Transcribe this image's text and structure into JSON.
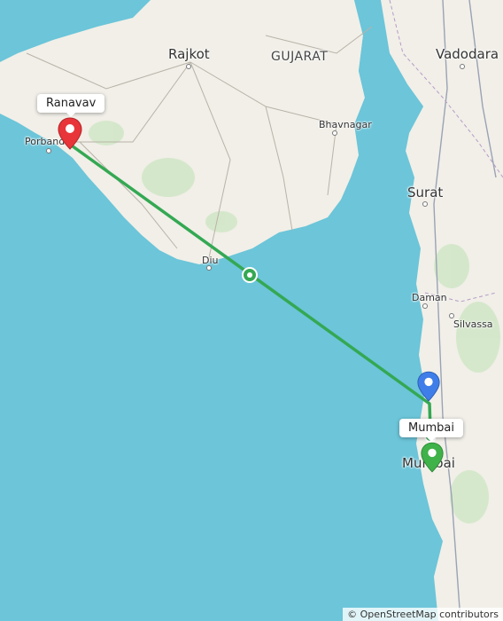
{
  "map": {
    "labels": {
      "rajkot": "Rajkot",
      "gujarat": "GUJARAT",
      "vadodara": "Vadodara",
      "bhavnagar": "Bhavnagar",
      "porbandar": "Porbandar",
      "surat": "Surat",
      "diu": "Diu",
      "daman": "Daman",
      "silvassa": "Silvassa",
      "mumbai": "Mumbai"
    },
    "markers": {
      "origin": {
        "label": "Ranavav",
        "color": "#e8353a"
      },
      "destination": {
        "label": "Mumbai",
        "color": "#3fb24a"
      },
      "current": {
        "color": "#3f7ee8"
      }
    },
    "route": {
      "color": "#34a853"
    },
    "attribution": "© OpenStreetMap contributors"
  }
}
